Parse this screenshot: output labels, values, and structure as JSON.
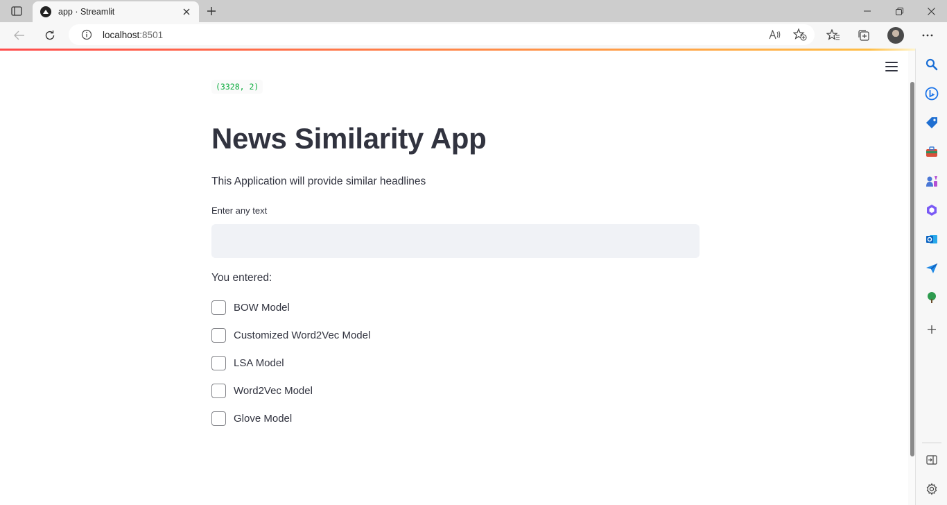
{
  "browser": {
    "tab_title": "app · Streamlit",
    "url_host": "localhost",
    "url_port": ":8501"
  },
  "page": {
    "code_output": "(3328, 2)",
    "title": "News Similarity App",
    "subtitle": "This Application will provide similar headlines",
    "input_label": "Enter any text",
    "input_value": "",
    "entered_label": "You entered:",
    "checkboxes": [
      {
        "label": "BOW Model",
        "checked": false
      },
      {
        "label": "Customized Word2Vec Model",
        "checked": false
      },
      {
        "label": "LSA Model",
        "checked": false
      },
      {
        "label": "Word2Vec Model",
        "checked": false
      },
      {
        "label": "Glove Model",
        "checked": false
      }
    ]
  },
  "colors": {
    "streamlit_primary": "#ff4b4b",
    "text": "#31333f",
    "code_green": "#09ab3b",
    "input_bg": "#f0f2f6"
  },
  "sidebar_icons": [
    "search-icon",
    "bing-icon",
    "shopping-tag-icon",
    "tools-icon",
    "games-icon",
    "office-icon",
    "outlook-icon",
    "send-icon",
    "tree-icon",
    "add-icon",
    "split-screen-icon",
    "settings-icon"
  ]
}
